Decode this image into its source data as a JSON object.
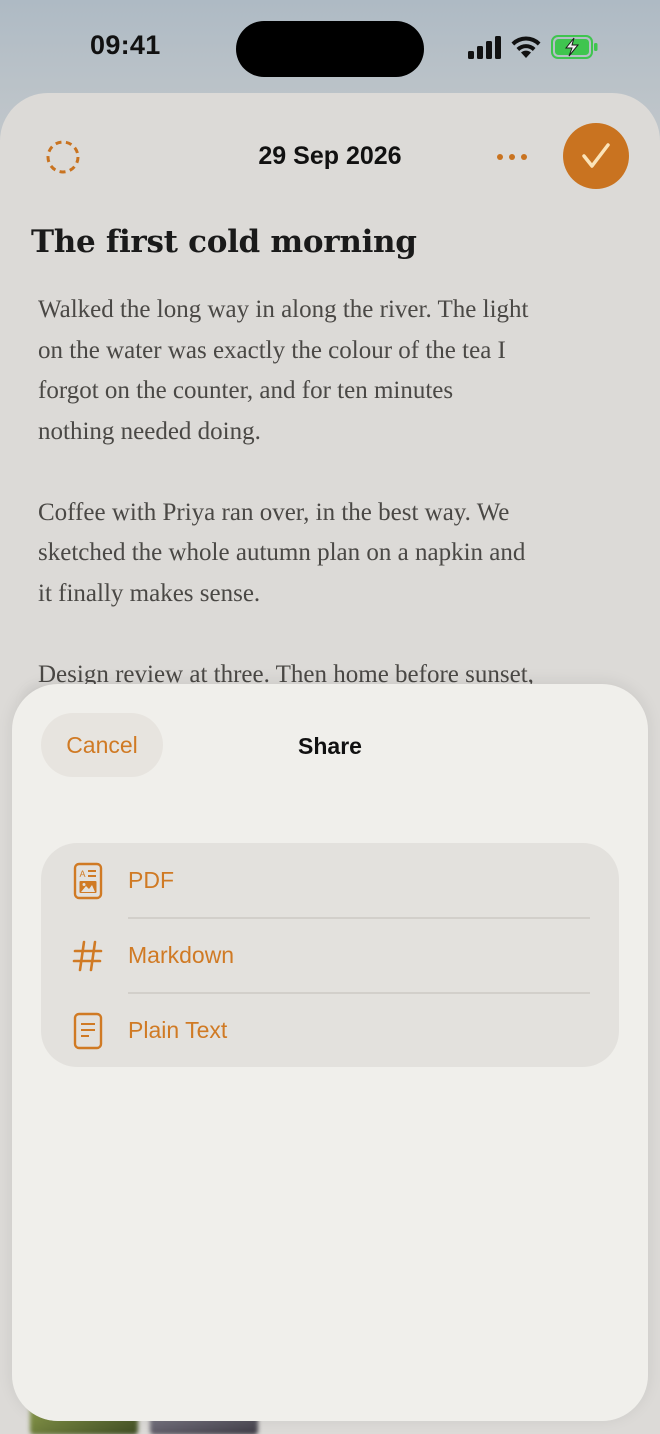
{
  "status_bar": {
    "time": "09:41"
  },
  "note": {
    "date": "29 Sep 2026",
    "title": "The first cold morning",
    "paragraphs": [
      [
        "Walked the long way in along the river. The light",
        "on the water was exactly the colour of the tea I",
        "forgot on the counter, and for ten minutes",
        "nothing needed doing."
      ],
      [
        "Coffee with Priya ran over, in the best way. We",
        "sketched the whole autumn plan on a napkin and",
        "it finally makes sense."
      ],
      [
        "Design review at three. Then home before sunset,"
      ]
    ]
  },
  "share_sheet": {
    "cancel_label": "Cancel",
    "title": "Share",
    "options": [
      {
        "label": "PDF",
        "icon": "pdf-document-icon"
      },
      {
        "label": "Markdown",
        "icon": "hash-icon"
      },
      {
        "label": "Plain Text",
        "icon": "text-document-icon"
      }
    ]
  },
  "colors": {
    "accent": "#d07a24",
    "done_button": "#c97320",
    "card_background": "#dcdad7",
    "sheet_background": "#f0efeb"
  }
}
